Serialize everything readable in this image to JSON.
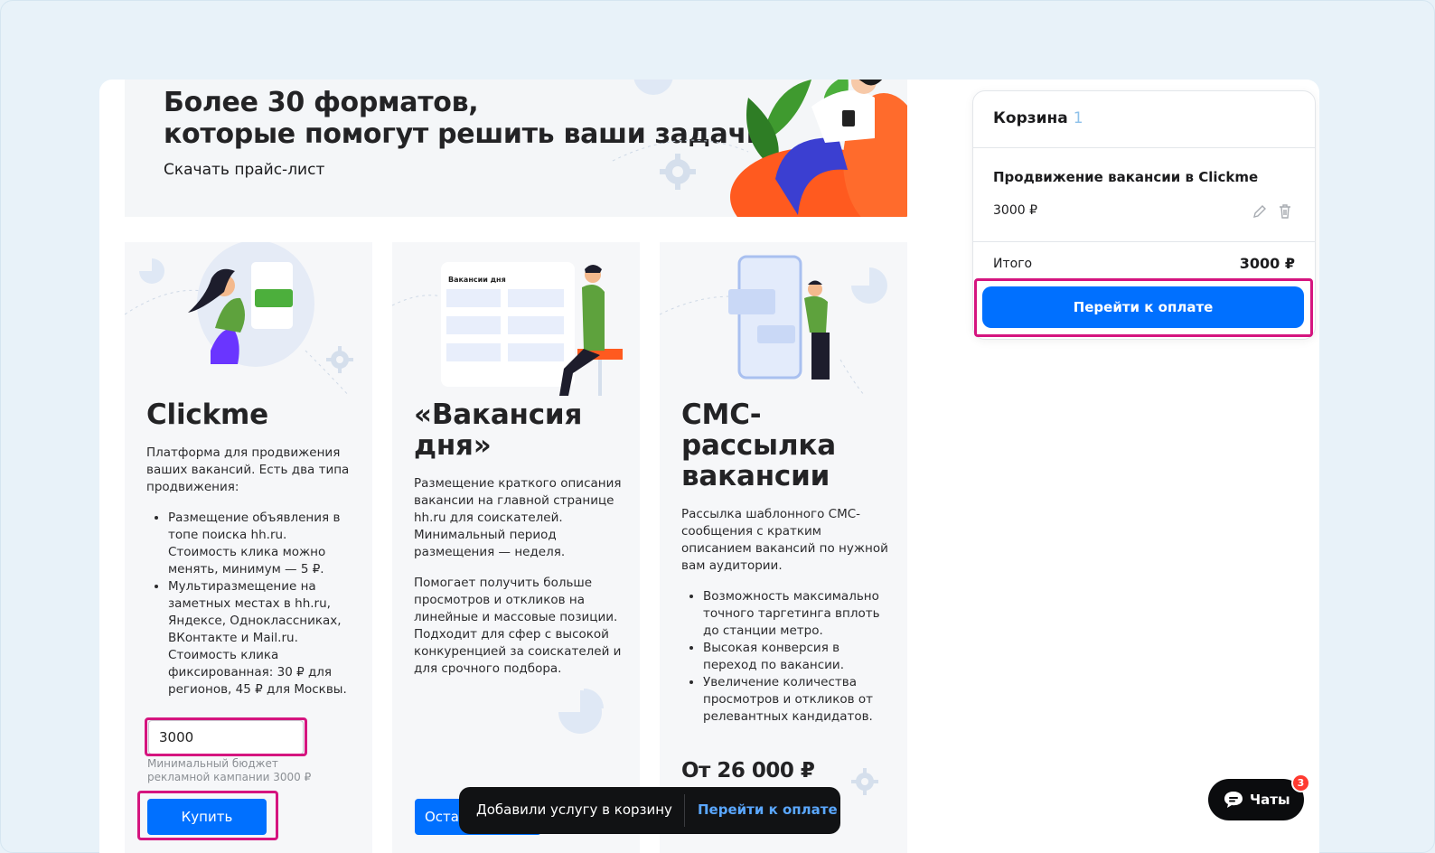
{
  "banner": {
    "title_line1": "Более 30 форматов,",
    "title_line2": "которые помогут решить ваши задачи.",
    "link": "Скачать прайс-лист"
  },
  "cards": [
    {
      "title": "Clickme",
      "intro": "Платформа для продвижения ваших вакансий. Есть два типа продвижения:",
      "bullets": [
        "Размещение объявления в топе поиска hh.ru. Стоимость клика можно менять, минимум — 5 ₽.",
        "Мультиразмещение на заметных местах в hh.ru, Яндексе, Одноклассниках, ВКонтакте и Mail.ru. Стоимость клика фиксированная: 30 ₽ для регионов, 45 ₽ для Москвы."
      ],
      "budget_value": "3000",
      "budget_hint": "Минимальный бюджет рекламной кампании 3000 ₽",
      "buy_label": "Купить"
    },
    {
      "title_line1": "«Вакансия",
      "title_line2": "дня»",
      "para1": "Размещение краткого описания вакансии на главной странице hh.ru для соискателей. Минимальный период размещения — неделя.",
      "para2": "Помогает получить больше просмотров и откликов на линейные и массовые позиции. Подходит для сфер с высокой конкуренцией за соискателей и для срочного подбора.",
      "button_label": "Оставить заявку",
      "art_header": "Вакансии дня"
    },
    {
      "title_line1": "СМС-",
      "title_line2": "рассылка",
      "title_line3": "вакансии",
      "intro": "Рассылка шаблонного СМС-сообщения с кратким описанием вакансий по нужной вам аудитории.",
      "bullets": [
        "Возможность максимально точного таргетинга вплоть до станции метро.",
        "Высокая конверсия в переход по вакансии.",
        "Увеличение количества просмотров и откликов от релевантных кандидатов."
      ],
      "price": "От 26 000 ₽"
    }
  ],
  "cart": {
    "title": "Корзина",
    "count": "1",
    "item_name": "Продвижение вакансии в Clickme",
    "item_price": "3000 ₽",
    "total_label": "Итого",
    "total_value": "3000 ₽",
    "checkout_label": "Перейти к оплате"
  },
  "toast": {
    "message": "Добавили услугу в корзину",
    "link": "Перейти к оплате"
  },
  "chat": {
    "label": "Чаты",
    "badge": "3"
  },
  "colors": {
    "accent": "#0070ff",
    "highlight": "#d5157f",
    "page_bg": "#e8f2f9"
  }
}
